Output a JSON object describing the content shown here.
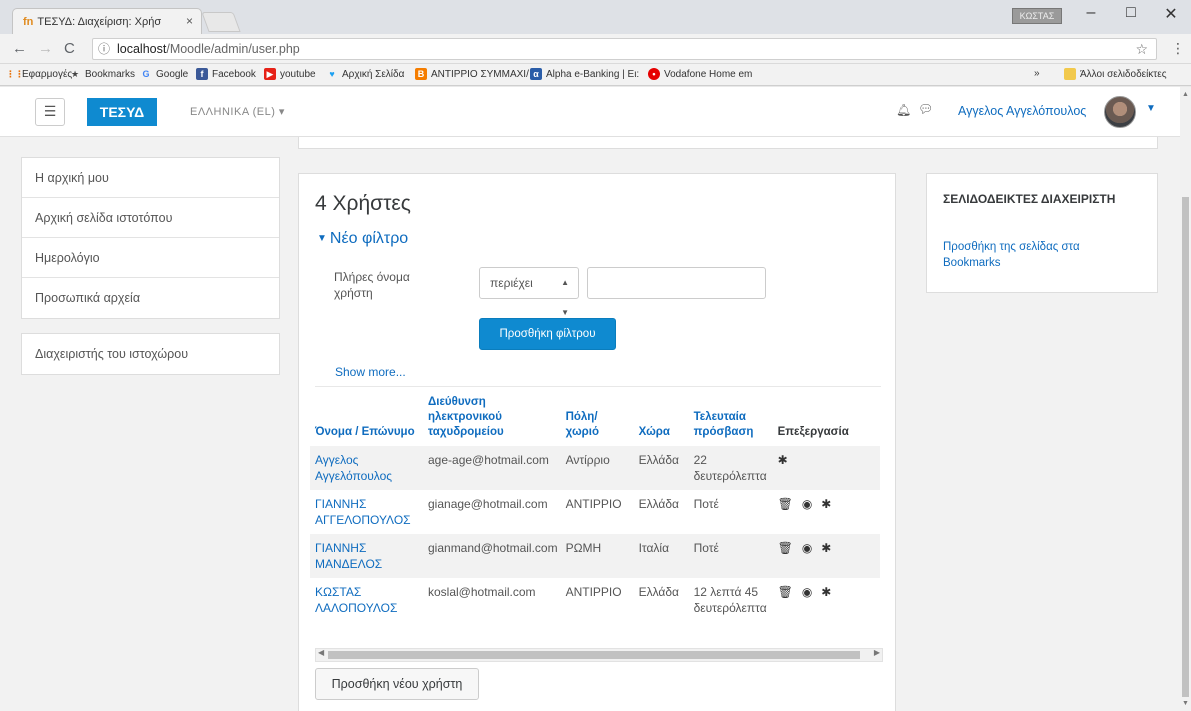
{
  "browser": {
    "tab_title": "ΤΕΣΥΔ: Διαχείριση: Χρήσ",
    "tab_close": "×",
    "favicon": "fn",
    "window_user": "ΚΩΣΤΑΣ",
    "minimize": "–",
    "maximize": "□",
    "close": "✕",
    "url_host": "localhost",
    "url_path": "/Moodle/admin/user.php",
    "bookmarks": [
      {
        "label": "Εφαρμογές",
        "icon": "apps-icon",
        "color": "#e8710a"
      },
      {
        "label": "Bookmarks",
        "icon": "star-icon",
        "color": "#444444"
      },
      {
        "label": "Google",
        "icon": "google-icon",
        "color": "#4285f4"
      },
      {
        "label": "Facebook",
        "icon": "facebook-icon",
        "color": "#3b5998"
      },
      {
        "label": "youtube",
        "icon": "youtube-icon",
        "color": "#e62117"
      },
      {
        "label": "Αρχική Σελίδα",
        "icon": "twitter-icon",
        "color": "#1da1f2"
      },
      {
        "label": "ΑΝΤΙΡΡΙΟ ΣΥΜΜΑΧΙ/",
        "icon": "blogger-icon",
        "color": "#f57d00"
      },
      {
        "label": "Alpha e-Banking | Ει:",
        "icon": "alpha-bank-icon",
        "color": "#2a5da8"
      },
      {
        "label": "Vodafone Home em",
        "icon": "vodafone-icon",
        "color": "#e60000"
      }
    ],
    "bookmarks_overflow": "»",
    "other_bookmarks": "Άλλοι σελιδοδείκτες"
  },
  "navbar": {
    "brand": "ΤΕΣΥΔ",
    "language": "ΕΛΛΗΝΙΚΑ (EL) ▾",
    "username": "Αγγελος Αγγελόπουλος"
  },
  "left_nav": {
    "items": [
      {
        "label": "Η αρχική μου"
      },
      {
        "label": "Αρχική σελίδα ιστοτόπου"
      },
      {
        "label": "Ημερολόγιο"
      },
      {
        "label": "Προσωπικά αρχεία"
      }
    ],
    "admin_label": "Διαχειριστής του ιστοχώρου"
  },
  "main": {
    "heading": "4 Χρήστες",
    "filter_legend": "Νέο φίλτρο",
    "filter_label": "Πλήρες όνομα χρήστη",
    "filter_select_value": "περιέχει",
    "filter_input_value": "",
    "add_filter_button": "Προσθήκη φίλτρου",
    "show_more": "Show more...",
    "add_user_button": "Προσθήκη νέου χρήστη"
  },
  "table": {
    "headers": {
      "name": "Όνομα / Επώνυμο",
      "email": "Διεύθυνση ηλεκτρονικού ταχυδρομείου",
      "city": "Πόλη/ χωριό",
      "country": "Χώρα",
      "last_access": "Τελευταία πρόσβαση",
      "edit": "Επεξεργασία"
    },
    "rows": [
      {
        "name": "Αγγελος Αγγελόπουλος",
        "email": "age-age@hotmail.com",
        "city": "Αντίρριο",
        "country": "Ελλάδα",
        "last_access": "22 δευτερόλεπτα",
        "actions": [
          "settings"
        ]
      },
      {
        "name": "ΓΙΑΝΝΗΣ ΑΓΓΕΛΟΠΟΥΛΟΣ",
        "email": "gianage@hotmail.com",
        "city": "ΑΝΤΙΡΡΙΟ",
        "country": "Ελλάδα",
        "last_access": "Ποτέ",
        "actions": [
          "delete",
          "view",
          "settings"
        ]
      },
      {
        "name": "ΓΙΑΝΝΗΣ ΜΑΝΔΕΛΟΣ",
        "email": "gianmand@hotmail.com",
        "city": "ΡΩΜΗ",
        "country": "Ιταλία",
        "last_access": "Ποτέ",
        "actions": [
          "delete",
          "view",
          "settings"
        ]
      },
      {
        "name": "ΚΩΣΤΑΣ ΛΑΛΟΠΟΥΛΟΣ",
        "email": "koslal@hotmail.com",
        "city": "ΑΝΤΙΡΡΙΟ",
        "country": "Ελλάδα",
        "last_access": "12 λεπτά 45 δευτερόλεπτα",
        "actions": [
          "delete",
          "view",
          "settings"
        ]
      }
    ]
  },
  "right_block": {
    "title": "ΣΕΛΙΔΟΔΕΙΚΤΕΣ ΔΙΑΧΕΙΡΙΣΤΗ",
    "link": "Προσθήκη της σελίδας στα Bookmarks"
  },
  "colors": {
    "brand": "#0f8ad0",
    "link": "#0f6cbf"
  }
}
